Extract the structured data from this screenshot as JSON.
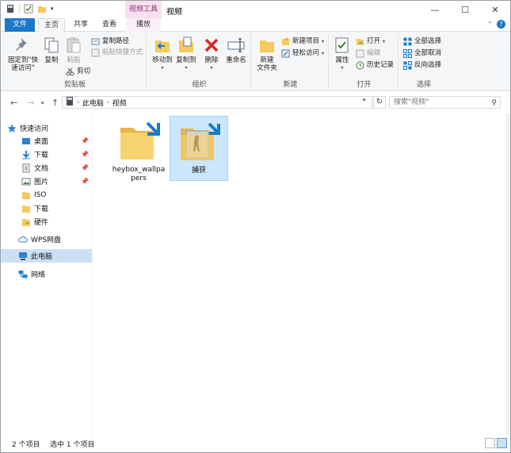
{
  "window": {
    "title": "视频",
    "contextual_tab_group": "视频工具",
    "caption_minimize": "—",
    "caption_maximize": "☐",
    "caption_close": "✕"
  },
  "tabs": [
    {
      "label": "文件"
    },
    {
      "label": "主页"
    },
    {
      "label": "共享"
    },
    {
      "label": "查看"
    },
    {
      "label": "播放"
    }
  ],
  "ribbon": {
    "clipboard": {
      "label": "剪贴板",
      "pin_quick": "固定到\"快\n速访问\"",
      "copy": "复制",
      "paste": "粘贴",
      "copy_path": "复制路径",
      "paste_shortcut": "粘贴快捷方式",
      "cut": "剪切"
    },
    "organize": {
      "label": "组织",
      "move_to": "移动到",
      "copy_to": "复制到",
      "delete": "删除",
      "rename": "重命名"
    },
    "new": {
      "label": "新建",
      "new_folder": "新建\n文件夹",
      "new_item": "新建项目",
      "easy_access": "轻松访问"
    },
    "open": {
      "label": "打开",
      "properties": "属性",
      "open": "打开",
      "edit": "编辑",
      "history": "历史记录"
    },
    "select": {
      "label": "选择",
      "select_all": "全部选择",
      "select_none": "全部取消",
      "invert": "反向选择"
    }
  },
  "address": {
    "back": "←",
    "forward": "→",
    "up": "↑",
    "crumbs": [
      "此电脑",
      "视频"
    ],
    "refresh": "↻",
    "search_placeholder": "搜索\"视频\""
  },
  "nav": {
    "quick_access": "快速访问",
    "items": [
      {
        "label": "桌面"
      },
      {
        "label": "下载"
      },
      {
        "label": "文档"
      },
      {
        "label": "图片"
      },
      {
        "label": "ISO"
      },
      {
        "label": "下载"
      },
      {
        "label": "硬件"
      }
    ],
    "wps": "WPS网盘",
    "this_pc": "此电脑",
    "network": "网络"
  },
  "files": [
    {
      "name": "heybox_wallpapers"
    },
    {
      "name": "捕获"
    }
  ],
  "status": {
    "count": "2 个项目",
    "selected": "选中 1 个项目"
  },
  "colors": {
    "accent": "#1979ca",
    "folder": "#f5c95a",
    "selection": "#cce6fb"
  }
}
